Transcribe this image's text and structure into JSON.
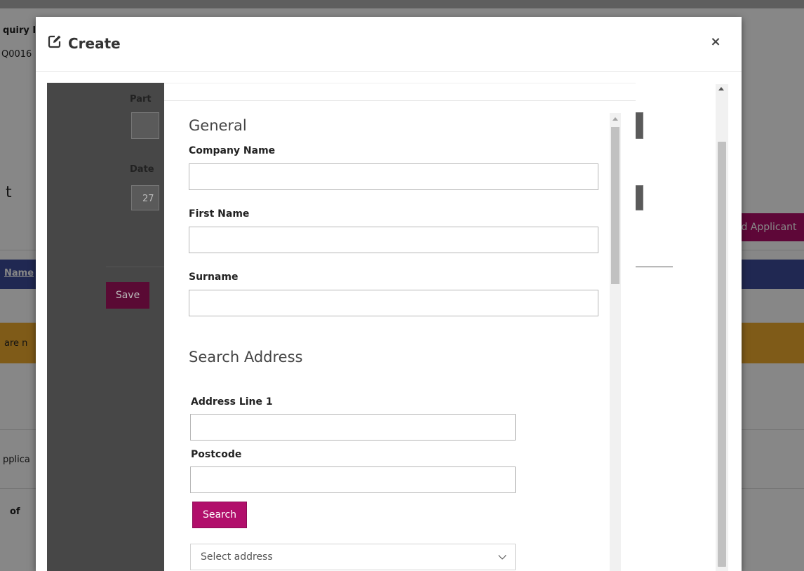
{
  "background": {
    "header_left": "quiry I",
    "ref_left": "Q0016",
    "title_fragment": "t",
    "part_label": "Part",
    "date_label": "Date",
    "date_value": "27",
    "add_applicant_label": "d Applicant",
    "name_header": "Name",
    "save_label": "Save",
    "warning_fragment": "are n",
    "applicants_fragment": "pplica",
    "pagination_of": "of"
  },
  "modal": {
    "title": "Create",
    "close_symbol": "×"
  },
  "form": {
    "general_title": "General",
    "company_name_label": "Company Name",
    "company_name_value": "",
    "first_name_label": "First Name",
    "first_name_value": "",
    "surname_label": "Surname",
    "surname_value": "",
    "search_address_title": "Search Address",
    "address_line1_label": "Address Line 1",
    "address_line1_value": "",
    "postcode_label": "Postcode",
    "postcode_value": "",
    "search_button": "Search",
    "select_address_placeholder": "Select address"
  },
  "colors": {
    "accent": "#b10f6b",
    "warning_band": "#f0ad2e",
    "nav_band": "#3e4c9b"
  },
  "icons": {
    "title_icon": "edit-icon",
    "close_icon": "close-icon",
    "select_icon": "chevron-down-icon"
  }
}
